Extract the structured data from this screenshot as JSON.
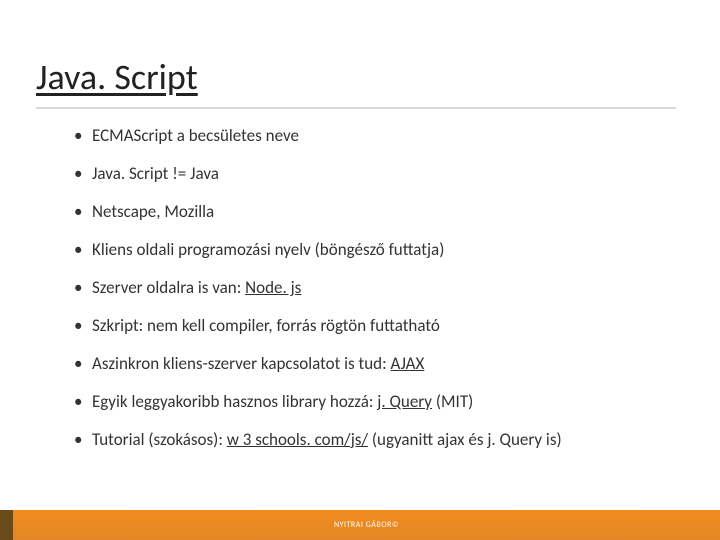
{
  "title": "Java. Script",
  "bullets": [
    {
      "pre": "ECMAScript a becsületes neve",
      "link": "",
      "post": ""
    },
    {
      "pre": "Java. Script != Java",
      "link": "",
      "post": ""
    },
    {
      "pre": "Netscape, Mozilla",
      "link": "",
      "post": ""
    },
    {
      "pre": "Kliens oldali programozási nyelv (böngésző futtatja)",
      "link": "",
      "post": ""
    },
    {
      "pre": "Szerver oldalra is van: ",
      "link": "Node. js",
      "post": ""
    },
    {
      "pre": "Szkript: nem kell compiler, forrás rögtön futtatható",
      "link": "",
      "post": ""
    },
    {
      "pre": "Aszinkron kliens-szerver kapcsolatot is tud: ",
      "link": "AJAX",
      "post": ""
    },
    {
      "pre": "Egyik leggyakoribb hasznos library hozzá: ",
      "link": "j. Query",
      "post": " (MIT)"
    },
    {
      "pre": "Tutorial (szokásos): ",
      "link": "w 3 schools. com/js/",
      "post": " (ugyanitt ajax és j. Query is)"
    }
  ],
  "footer": "NYITRAI GÁBOR©"
}
